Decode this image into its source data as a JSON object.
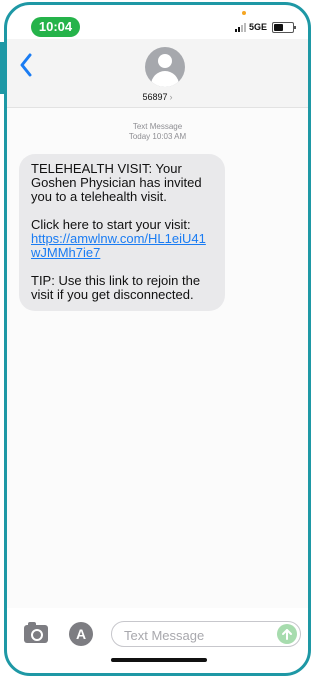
{
  "status_bar": {
    "time": "10:04",
    "network": "5GE"
  },
  "header": {
    "back_icon": "chevron-left-icon",
    "contact": "56897",
    "contact_chevron": "›"
  },
  "thread": {
    "meta_label": "Text Message",
    "meta_time": "Today 10:03 AM",
    "message": {
      "para1": "TELEHEALTH VISIT: Your Goshen Physician has invited you to a telehealth visit.",
      "para2_text": "Click here to start your visit:",
      "link": "https://amwlnw.com/HL1eiU41wJMMh7ie7",
      "para3": "TIP: Use this link to rejoin the visit if you get disconnected."
    }
  },
  "compose": {
    "placeholder": "Text Message",
    "send_icon": "arrow-up-icon"
  },
  "colors": {
    "frame": "#1e98a5",
    "time_pill": "#25b34a",
    "link": "#1a7cf3",
    "bubble": "#e9e9eb",
    "send_button": "#a7dcae"
  }
}
